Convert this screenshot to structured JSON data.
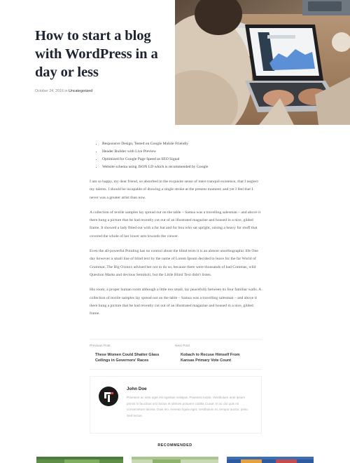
{
  "post": {
    "title": "How to start a blog with WordPress in a day or less",
    "date": "October 24, 2016",
    "meta_in": "in",
    "category": "Uncategorized"
  },
  "features": [
    "Responsive Design, Tested on Google Mobile Friendly",
    "Header Builder with Live Preview",
    "Optimized for Google Page Speed as SEO Signal",
    "Website schema using JSON LD which is recommended by Google"
  ],
  "paragraphs": [
    "I am so happy, my dear friend, so absorbed in the exquisite sense of mere tranquil existence, that I neglect my talents. I should be incapable of drawing a single stroke at the present moment; and yet I feel that I never was a greater artist than now.",
    "A collection of textile samples lay spread out on the table – Samsa was a travelling salesman – and above it there hung a picture that he had recently cut out of an illustrated magazine and housed in a nice, gilded frame. It showed a lady fitted out with a fur hat and fur boa who sat upright, raising a heavy fur muff that covered the whole of her lower arm towards the viewer.",
    "Even the all-powerful Pointing has no control about the blind texts it is an almost unorthographic life One day however a small line of blind text by the name of Lorem Ipsum decided to leave for the far World of Grammar. The Big Oxmox advised her not to do so, because there were thousands of bad Commas, wild Question Marks and devious Semikoli, but the Little Blind Text didn't listen.",
    "His room, a proper human room although a little too small, lay peacefully between its four familiar walls. A collection of textile samples lay spread out on the table – Samsa was a travelling salesman – and above it there hung a picture that he had recently cut out of an illustrated magazine and housed in a nice, gilded frame."
  ],
  "navigation": {
    "previous_label": "Previous Post",
    "previous_title": "These Women Could Shatter Glass Ceilings in Governors' Races",
    "next_label": "Next Post",
    "next_title": "Kobach to Recuse Himself From Kansas Primary Vote Count"
  },
  "author": {
    "name": "John Doe",
    "bio": "Praesent ac sem eget est egestas volutpat. Praesent turpis. Vestibulum ante ipsum primis in faucibus orci luctus et ultrices posuere cubilia Curae; In ac dui quis mi consectetuer lacinia. Duis leo. Aenean ligula eget, vestibulum et, tempor auctor, justo. Sed lectus."
  },
  "recommended": {
    "heading": "RECOMMENDED"
  },
  "colors": {
    "title": "#1d2330",
    "body_text": "#555555",
    "muted": "#999999"
  }
}
